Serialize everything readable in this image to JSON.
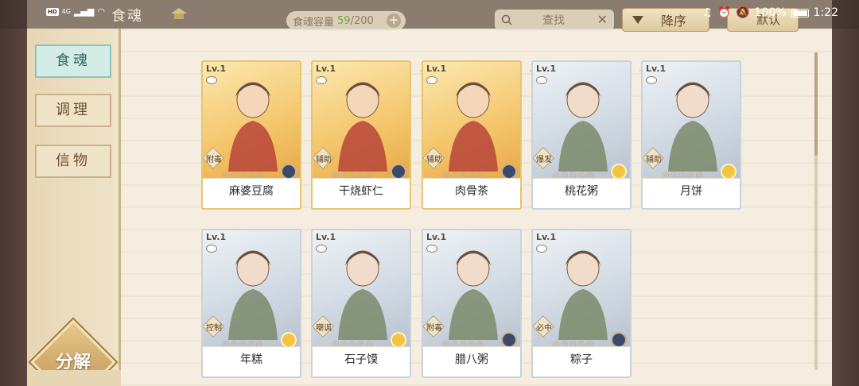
{
  "status_bar": {
    "hd": "HD",
    "signal": "4G",
    "battery_pct": "100%",
    "time": "1:22"
  },
  "header": {
    "title": "食魂",
    "capacity_label": "食魂容量",
    "capacity_current": "59",
    "capacity_max": "/200",
    "search_placeholder": "查找",
    "sort_label": "降序",
    "default_label": "默认"
  },
  "sidebar": {
    "tabs": [
      {
        "label": "食魂",
        "active": true
      },
      {
        "label": "调理",
        "active": false
      },
      {
        "label": "信物",
        "active": false
      }
    ],
    "decompose_label": "分解"
  },
  "cards": [
    {
      "name": "麻婆豆腐",
      "level": "Lv.1",
      "role": "附毒",
      "frame": "gold",
      "element": "dark"
    },
    {
      "name": "干烧虾仁",
      "level": "Lv.1",
      "role": "辅助",
      "frame": "gold",
      "element": "dark"
    },
    {
      "name": "肉骨茶",
      "level": "Lv.1",
      "role": "辅助",
      "frame": "gold",
      "element": "dark"
    },
    {
      "name": "桃花粥",
      "level": "Lv.1",
      "role": "爆发",
      "frame": "silver",
      "element": "gold"
    },
    {
      "name": "月饼",
      "level": "Lv.1",
      "role": "辅助",
      "frame": "silver",
      "element": "gold"
    },
    {
      "name": "年糕",
      "level": "Lv.1",
      "role": "控制",
      "frame": "silver",
      "element": "gold"
    },
    {
      "name": "石子馍",
      "level": "Lv.1",
      "role": "嘲讽",
      "frame": "silver",
      "element": "gold"
    },
    {
      "name": "腊八粥",
      "level": "Lv.1",
      "role": "附毒",
      "frame": "silver",
      "element": "dark"
    },
    {
      "name": "粽子",
      "level": "Lv.1",
      "role": "必中",
      "frame": "silver",
      "element": "dark"
    }
  ],
  "colors": {
    "frame": "#4a3731",
    "panel": "#f3ecdd",
    "active_tab": "#d3ece6",
    "capacity_current": "#6fa34a"
  }
}
